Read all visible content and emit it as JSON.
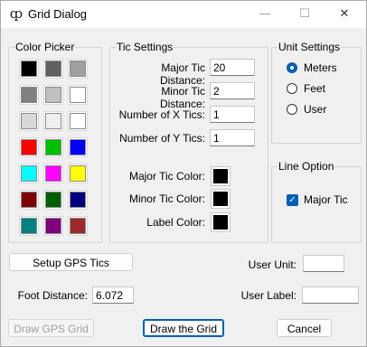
{
  "window": {
    "title": "Grid Dialog",
    "icon": "app-logo-icon"
  },
  "color_picker": {
    "legend": "Color Picker",
    "swatches": [
      "#000000",
      "#606060",
      "#a0a0a0",
      "#808080",
      "#c0c0c0",
      "#ffffff",
      "#d8d8d8",
      "#efefef",
      "#ffffff",
      "#ff0000",
      "#00c000",
      "#0000ff",
      "#00ffff",
      "#ff00ff",
      "#ffff00",
      "#800000",
      "#006000",
      "#000080",
      "#008080",
      "#800080",
      "#a02828"
    ]
  },
  "tic_settings": {
    "legend": "Tic Settings",
    "major_distance_label": "Major Tic Distance:",
    "major_distance": "20",
    "minor_distance_label": "Minor Tic Distance:",
    "minor_distance": "2",
    "x_tics_label": "Number of X Tics:",
    "x_tics": "1",
    "y_tics_label": "Number of Y Tics:",
    "y_tics": "1",
    "major_color_label": "Major Tic Color:",
    "major_color": "#000000",
    "minor_color_label": "Minor Tic Color:",
    "minor_color": "#000000",
    "label_color_label": "Label Color:",
    "label_color": "#000000"
  },
  "unit_settings": {
    "legend": "Unit Settings",
    "options": [
      "Meters",
      "Feet",
      "User"
    ],
    "selected": "Meters"
  },
  "line_option": {
    "legend": "Line Option",
    "major_tic_label": "Major Tic",
    "major_tic_checked": true
  },
  "gps": {
    "setup_label": "Setup GPS Tics",
    "foot_distance_label": "Foot Distance:",
    "foot_distance": "6.072"
  },
  "user": {
    "unit_label": "User Unit:",
    "unit_value": "",
    "label_label": "User Label:",
    "label_value": ""
  },
  "buttons": {
    "draw_gps": "Draw GPS Grid",
    "draw_grid": "Draw the Grid",
    "cancel": "Cancel"
  }
}
